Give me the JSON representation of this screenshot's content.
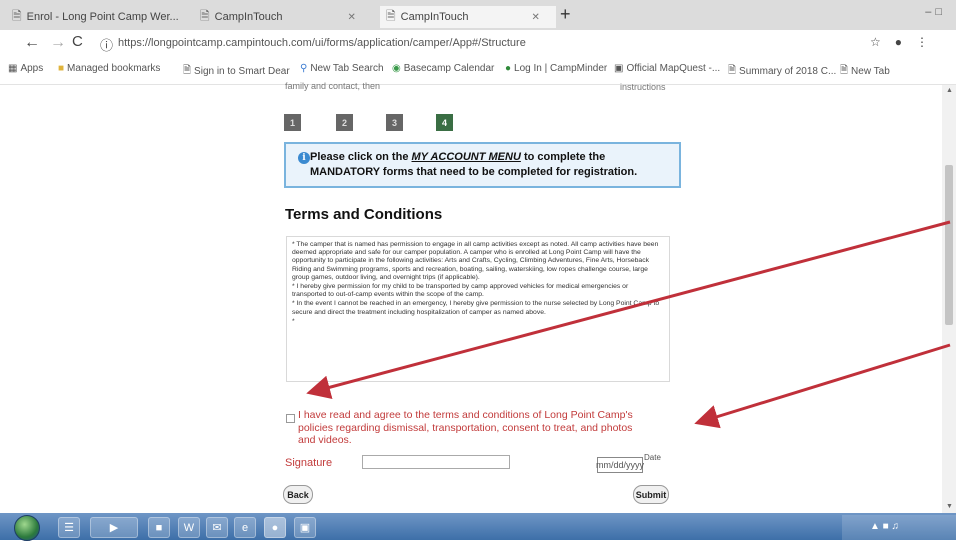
{
  "browser": {
    "tabs": [
      {
        "label": "Enrol - Long Point Camp Wer..."
      },
      {
        "label": "CampInTouch"
      },
      {
        "label": "CampInTouch"
      }
    ],
    "url": "https://longpointcamp.campintouch.com/ui/forms/application/camper/App#/Structure",
    "bookmarks": [
      {
        "label": "Apps",
        "icon": "apps-icon"
      },
      {
        "label": "Managed bookmarks",
        "icon": "folder-icon"
      },
      {
        "label": "Sign in to Smart Dear",
        "icon": "doc-icon"
      },
      {
        "label": "New Tab Search",
        "icon": "search-icon"
      },
      {
        "label": "Basecamp Calendar",
        "icon": "calendar-icon"
      },
      {
        "label": "Log In | CampMinder",
        "icon": "dot-icon"
      },
      {
        "label": "Official MapQuest -...",
        "icon": "map-icon"
      },
      {
        "label": "Summary of 2018 C...",
        "icon": "doc-icon"
      },
      {
        "label": "New Tab",
        "icon": "doc-icon"
      }
    ]
  },
  "page": {
    "top_note_left": "family and contact, then",
    "top_note_right": "instructions",
    "steps": [
      "1",
      "2",
      "3",
      "4"
    ],
    "info": {
      "prefix": "Please click on the ",
      "link": "MY ACCOUNT MENU",
      "suffix": " to complete the MANDATORY forms that need to be completed for registration."
    },
    "terms_heading": "Terms and Conditions",
    "terms_paragraphs": [
      "* The camper that is named has permission to engage in all camp activities except as noted. All camp activities have been deemed appropriate and safe for our camper population. A camper who is enrolled at Long Point Camp will have the opportunity to participate in the following activities: Arts and Crafts, Cycling, Climbing Adventures, Fine Arts, Horseback Riding and Swimming programs, sports and recreation, boating, sailing, waterskiing, low ropes challenge course, large group games, outdoor living, and overnight trips (if applicable).",
      "* I hereby give permission for my child to be transported by camp approved vehicles for medical emergencies or transported to out-of-camp events within the scope of the camp.",
      "* In the event I cannot be reached in an emergency, I hereby give permission to the nurse selected by Long Point Camp to secure and direct the treatment including hospitalization of camper as named above.",
      "*"
    ],
    "agree_text": "I have read and agree to the terms and conditions of Long Point Camp's policies regarding dismissal, transportation, consent to treat, and photos and videos.",
    "signature_label": "Signature",
    "signature_placeholder": "",
    "date_value": "mm/dd/yyyy",
    "date_hint": "Date",
    "back_label": "Back",
    "submit_label": "Submit"
  },
  "colors": {
    "arrow": "#c0303a",
    "active_step": "#3a6e44",
    "info_border": "#7ab4de",
    "agree_text": "#c23b3b"
  },
  "taskbar": {
    "icons": [
      "explorer-icon",
      "media-icon",
      "folder-icon",
      "word-icon",
      "outlook-icon",
      "ie-icon",
      "chrome-icon",
      "video-icon"
    ]
  }
}
